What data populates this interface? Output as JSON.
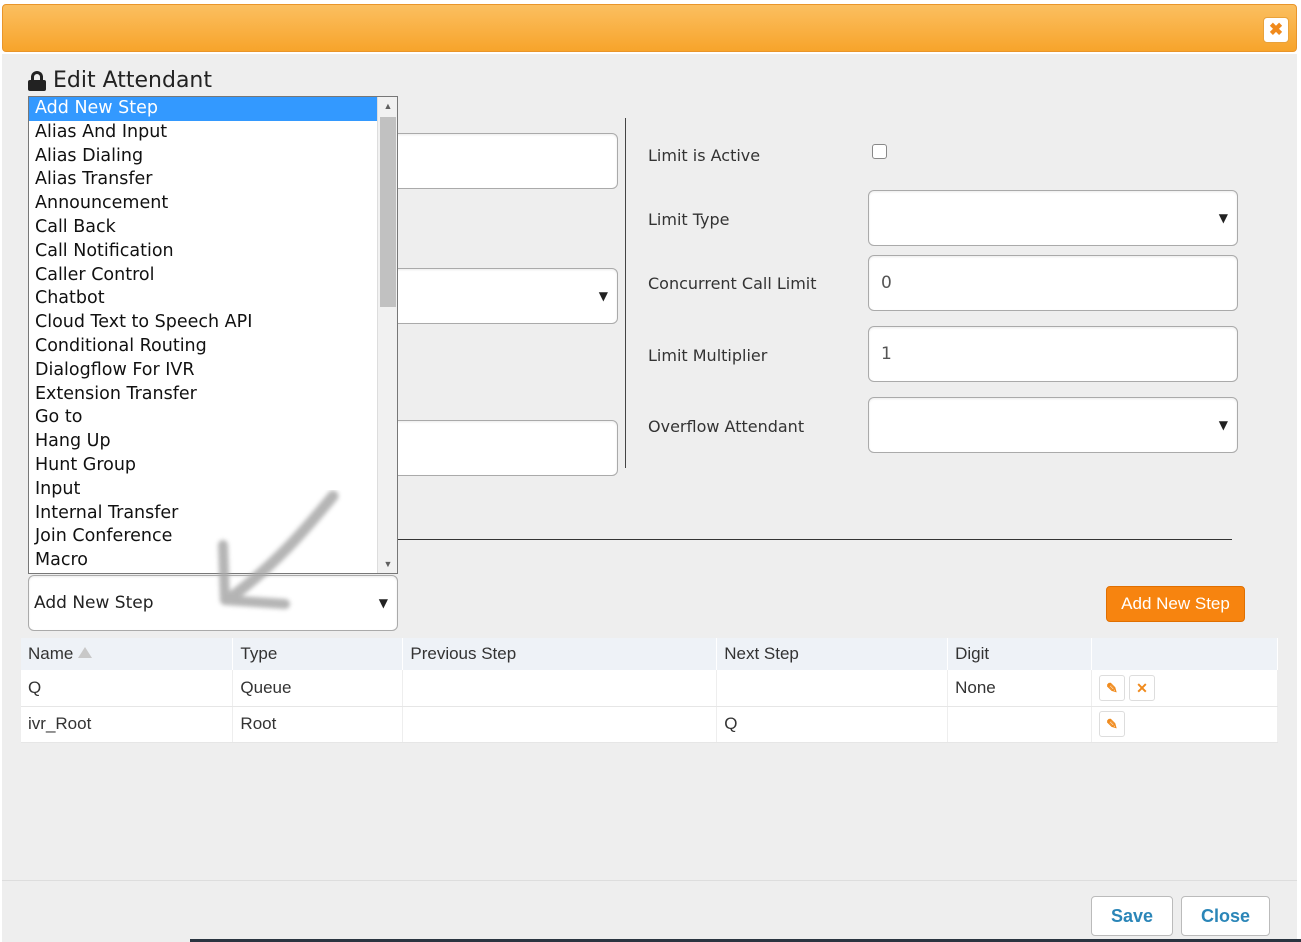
{
  "header": {
    "close_glyph": "✖"
  },
  "dialog": {
    "title": "Edit Attendant"
  },
  "limits": {
    "limit_is_active_label": "Limit is Active",
    "limit_is_active": false,
    "limit_type_label": "Limit Type",
    "limit_type_value": "",
    "concurrent_call_limit_label": "Concurrent Call Limit",
    "concurrent_call_limit_value": "0",
    "limit_multiplier_label": "Limit Multiplier",
    "limit_multiplier_value": "1",
    "overflow_attendant_label": "Overflow Attendant",
    "overflow_attendant_value": ""
  },
  "step_dropdown": {
    "selected": "Add New Step",
    "options": [
      "Add New Step",
      "Alias And Input",
      "Alias Dialing",
      "Alias Transfer",
      "Announcement",
      "Call Back",
      "Call Notification",
      "Caller Control",
      "Chatbot",
      "Cloud Text to Speech API",
      "Conditional Routing",
      "Dialogflow For IVR",
      "Extension Transfer",
      "Go to",
      "Hang Up",
      "Hunt Group",
      "Input",
      "Internal Transfer",
      "Join Conference",
      "Macro"
    ]
  },
  "add_step_button": "Add New Step",
  "steps_table": {
    "headers": [
      "Name",
      "Type",
      "Previous Step",
      "Next Step",
      "Digit",
      ""
    ],
    "rows": [
      {
        "name": "Q",
        "type": "Queue",
        "previous": "",
        "next": "",
        "digit": "None",
        "deletable": true
      },
      {
        "name": "ivr_Root",
        "type": "Root",
        "previous": "",
        "next": "Q",
        "digit": "",
        "deletable": false
      }
    ]
  },
  "footer": {
    "save_label": "Save",
    "close_label": "Close"
  },
  "colors": {
    "accent": "#f7840f",
    "link_blue": "#2b86b8",
    "selected_blue": "#3399ff"
  }
}
